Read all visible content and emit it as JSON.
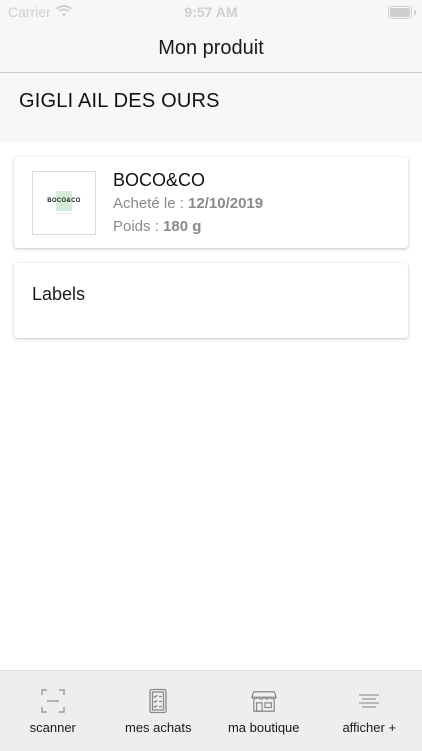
{
  "status_bar": {
    "carrier": "Carrier",
    "time": "9:57 AM"
  },
  "nav": {
    "title": "Mon produit"
  },
  "product": {
    "name": "GIGLI AIL DES OURS",
    "brand": "BOCO&CO",
    "logo_text": "BOCO&CO",
    "purchase_label": "Acheté le : ",
    "purchase_date": "12/10/2019",
    "weight_label": "Poids : ",
    "weight_value": "180 g"
  },
  "labels_section": {
    "title": "Labels"
  },
  "tab_bar": {
    "items": [
      {
        "label": "scanner",
        "icon": "scan-icon"
      },
      {
        "label": "mes achats",
        "icon": "receipt-icon"
      },
      {
        "label": "ma boutique",
        "icon": "store-icon"
      },
      {
        "label": "afficher +",
        "icon": "menu-icon"
      }
    ]
  },
  "colors": {
    "background": "#ffffff",
    "bar_background": "#f7f7f7",
    "tab_bar_background": "#eeeeee",
    "muted_text": "#8a8a8a",
    "logo_accent": "#d6ead8"
  }
}
